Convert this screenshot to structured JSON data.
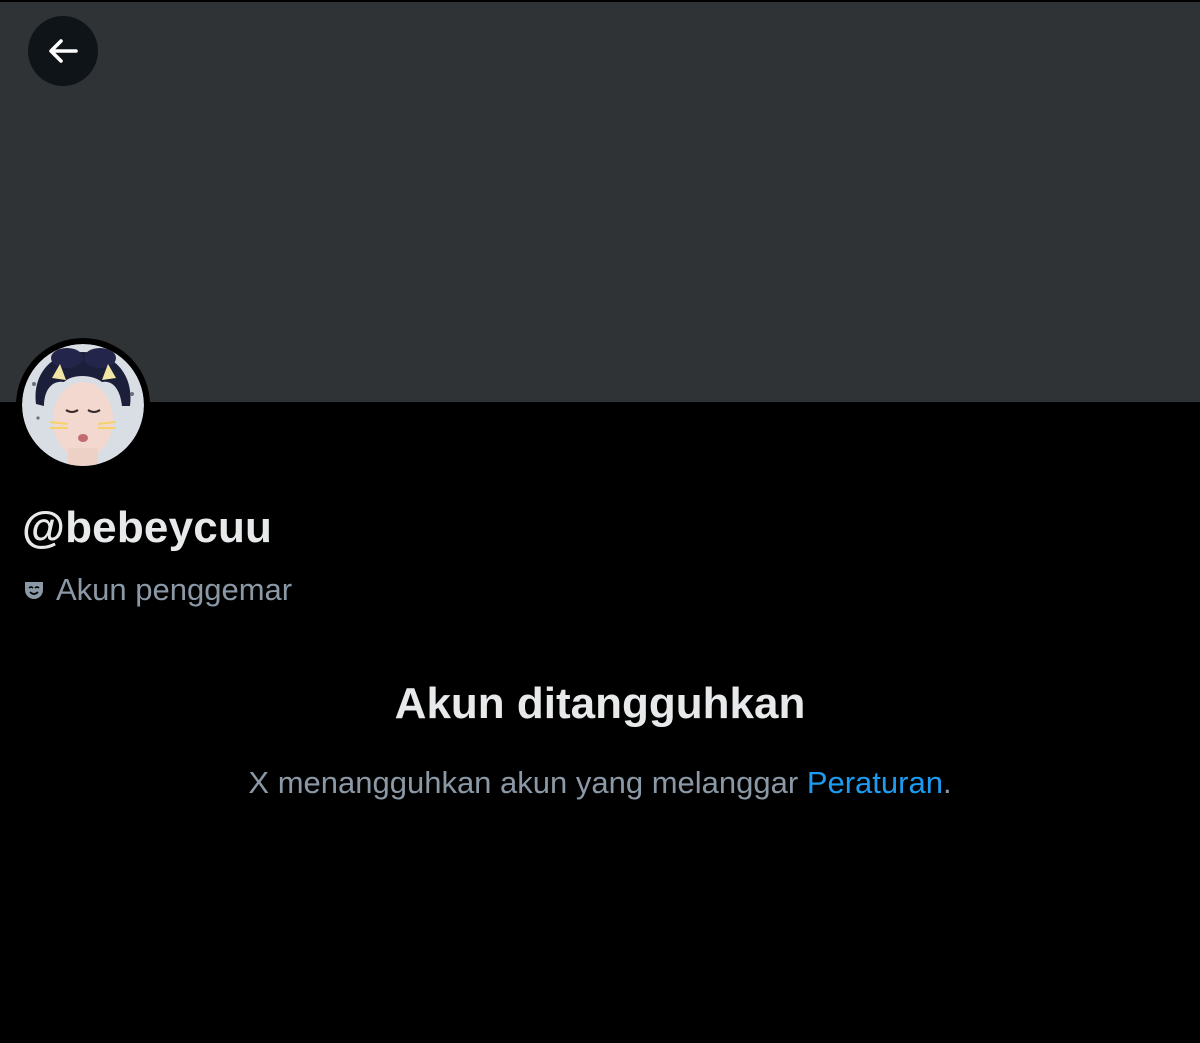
{
  "profile": {
    "handle": "@bebeycuu",
    "category_icon": "masks-icon",
    "category_label": "Akun penggemar"
  },
  "suspension": {
    "title": "Akun ditangguhkan",
    "message": "X menangguhkan akun yang melanggar",
    "link_label": "Peraturan",
    "trailing_punctuation": "."
  },
  "colors": {
    "background": "#000000",
    "banner": "#2f3336",
    "primary_text": "#e7e9ea",
    "secondary_text": "#8b98a5",
    "link": "#1d9bf0"
  }
}
